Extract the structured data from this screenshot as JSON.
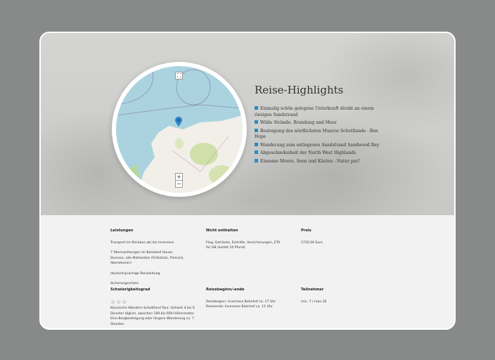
{
  "hero": {
    "title": "Reise-Highlights",
    "highlights": [
      "Einmalig schön gelegene Unterkunft direkt an einem riesigen Sandstrand",
      "Wilde Strände, Brandung und Meer",
      "Besteigung des nördlichsten Munros Schottlands - Ben Hope",
      "Wanderung zum entlegenen Sandstrand Sandwood Bay",
      "Abgeschiedenheit der North West Highlands",
      "Einsame Moore, Seen und Küsten - Natur pur!"
    ],
    "bullet_color": "#2b8ac3"
  },
  "map": {
    "zoom_in": "+",
    "zoom_out": "−",
    "fullscreen_icon": "fullscreen-icon",
    "marker_color": "#2a81cb"
  },
  "details": {
    "leistungen": {
      "heading": "Leistungen",
      "items": [
        "Transport im Kleinbus ab/ bis Inverness",
        "7 Übernachtungen im Balnakeil House, Durness, alle Mahlzeiten (Frühstück, Picknick, Abendessen)",
        "deutschsprachige Reiseleitung",
        "Sicherungsschein"
      ]
    },
    "nicht": {
      "heading": "Nicht enthalten",
      "text": "Flug, Getränke, Eintritte, Versicherungen, ETA für GB (kostet 10 Pfund)"
    },
    "preis": {
      "heading": "Preis",
      "text": "1720.00 Euro"
    },
    "schwierigkeit": {
      "heading": "Schwierigkeitsgrad",
      "stars": "☆☆☆",
      "level": 3,
      "text": "Klassische Wandern Schottland Tour. Gehzeit 4 bis 6 Stunden täglich, zwischen 100 bis 600 Höhenmeter. Eine Bergbesteigung oder längere Wanderung ca. 7 Stunden."
    },
    "reise": {
      "heading": "Reisebeginn/-ende",
      "start": "Reisebeginn: Inverness Bahnhof ca. 17 Uhr",
      "end": "Reiseende: Inverness Bahnhof ca. 11 Uhr"
    },
    "teilnehmer": {
      "heading": "Teilnehmer",
      "text": "min. 7 / max.16"
    }
  }
}
